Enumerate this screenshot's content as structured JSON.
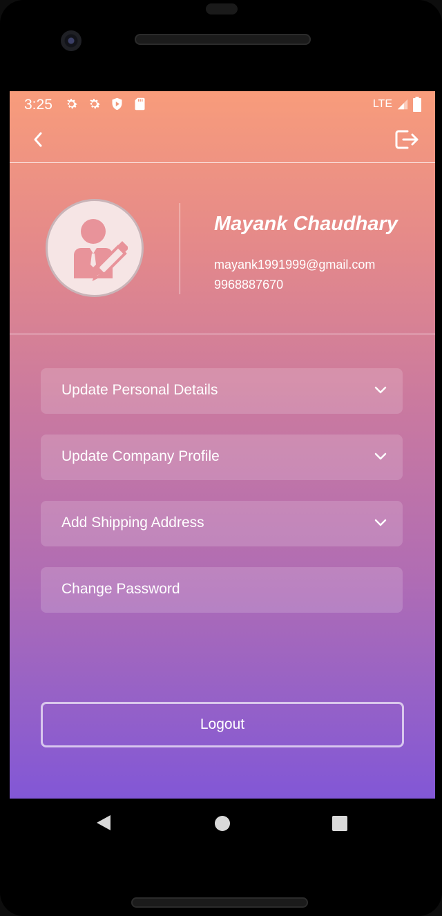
{
  "status_bar": {
    "time": "3:25",
    "network": "LTE",
    "icons": [
      "gear-icon",
      "gear-icon",
      "shield-play-icon",
      "sd-card-icon"
    ]
  },
  "app_bar": {
    "back_icon": "chevron-left-icon",
    "logout_icon": "logout-icon"
  },
  "profile": {
    "name": "Mayank Chaudhary",
    "email": "mayank1991999@gmail.com",
    "phone": "9968887670",
    "avatar_icon": "user-edit-icon"
  },
  "menu": {
    "items": [
      {
        "label": "Update Personal Details",
        "expandable": true
      },
      {
        "label": "Update Company Profile",
        "expandable": true
      },
      {
        "label": "Add Shipping Address",
        "expandable": true
      },
      {
        "label": "Change Password",
        "expandable": false
      }
    ]
  },
  "logout_button": {
    "label": "Logout"
  },
  "colors": {
    "gradient_top": "#f89c7b",
    "gradient_bottom": "#8257d6"
  }
}
